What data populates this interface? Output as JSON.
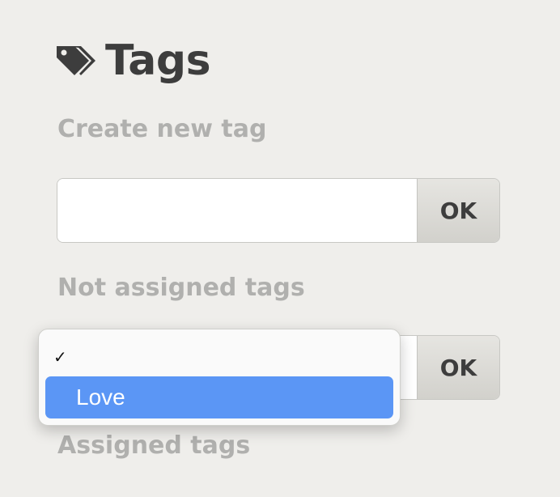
{
  "header": {
    "title": "Tags",
    "icon": "tag-icon"
  },
  "create": {
    "label": "Create new tag",
    "input_value": "",
    "input_placeholder": "",
    "ok_label": "OK"
  },
  "not_assigned": {
    "label": "Not assigned tags",
    "selected_value": "",
    "ok_label": "OK",
    "options": [
      {
        "label": "",
        "checked": true
      },
      {
        "label": "Love",
        "highlighted": true
      }
    ],
    "check_mark": "✓"
  },
  "assigned": {
    "label": "Assigned tags"
  },
  "colors": {
    "highlight": "#5b96f5",
    "background": "#efeeeb",
    "label_gray": "#b0b0ae"
  }
}
